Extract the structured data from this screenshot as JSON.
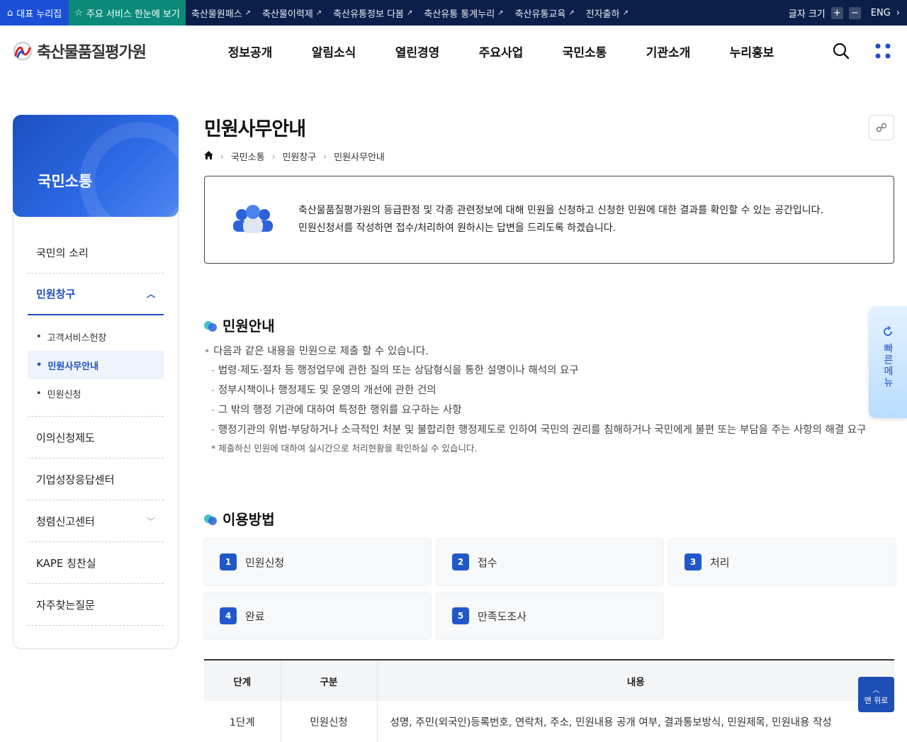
{
  "topbar": {
    "home_label": "대표 누리집",
    "services_label": "주요 서비스 한눈에 보기",
    "links": [
      "축산물원패스",
      "축산물이력제",
      "축산유통정보 다봄",
      "축산유통 통계누리",
      "축산유통교육",
      "전자출하"
    ],
    "font_size_label": "글자 크기",
    "font_plus": "+",
    "font_minus": "−",
    "lang_label": "ENG"
  },
  "header": {
    "logo_text": "축산물품질평가원",
    "nav": [
      "정보공개",
      "알림소식",
      "열린경영",
      "주요사업",
      "국민소통",
      "기관소개",
      "누리홍보"
    ]
  },
  "sidebar": {
    "title": "국민소통",
    "items": [
      {
        "label": "국민의 소리"
      },
      {
        "label": "민원창구"
      },
      {
        "label": "이의신청제도"
      },
      {
        "label": "기업성장응답센터"
      },
      {
        "label": "청렴신고센터"
      },
      {
        "label": "KAPE 칭찬실"
      },
      {
        "label": "자주찾는질문"
      }
    ],
    "sub_items": [
      "고객서비스헌장",
      "민원사무안내",
      "민원신청"
    ]
  },
  "main": {
    "page_title": "민원사무안내",
    "breadcrumb": [
      "국민소통",
      "민원창구",
      "민원사무안내"
    ],
    "intro_line1": "축산물품질평가원의 등급판정 및 각종 관련정보에 대해 민원을 신청하고 신청한 민원에 대한 결과를 확인할 수 있는 공간입니다.",
    "intro_line2": "민원신청서를 작성하면 접수/처리하여 원하시는 답변을 드리도록 하겠습니다.",
    "section1_title": "민원안내",
    "lead": "다음과 같은 내용을 민원으로 제출 할 수 있습니다.",
    "bullets": [
      "법령·제도·절차 등 행정업무에 관한 질의 또는 상담형식을 통한 설명이나 해석의 요구",
      "정부시책이나 행정제도 및 운영의 개선에 관한 건의",
      "그 밖의 행정 기관에 대하여 특정한 행위를 요구하는 사항",
      "행정기관의 위법·부당하거나 소극적인 처분 및 불합리한 행정제도로 인하여 국민의 권리를 침해하거나 국민에게 불편 또는 부담을 주는 사항의 해결 요구"
    ],
    "note": "* 제출하신 민원에 대하여 실시간으로 처리현황을 확인하실 수 있습니다.",
    "section2_title": "이용방법",
    "steps": [
      {
        "num": "1",
        "label": "민원신청"
      },
      {
        "num": "2",
        "label": "접수"
      },
      {
        "num": "3",
        "label": "처리"
      },
      {
        "num": "4",
        "label": "완료"
      },
      {
        "num": "5",
        "label": "만족도조사"
      }
    ],
    "table": {
      "headers": [
        "단계",
        "구분",
        "내용"
      ],
      "rows": [
        [
          "1단계",
          "민원신청",
          "성명, 주민(외국인)등록번호, 연락처, 주소, 민원내용 공개 여부, 결과통보방식, 민원제목, 민원내용 작성"
        ]
      ]
    }
  },
  "quick_menu_label": "빠른메뉴",
  "to_top_label": "맨 위로",
  "colors": {
    "primary": "#1f4fbf",
    "topbar": "#0b1f4a",
    "services": "#0b8a7a"
  }
}
